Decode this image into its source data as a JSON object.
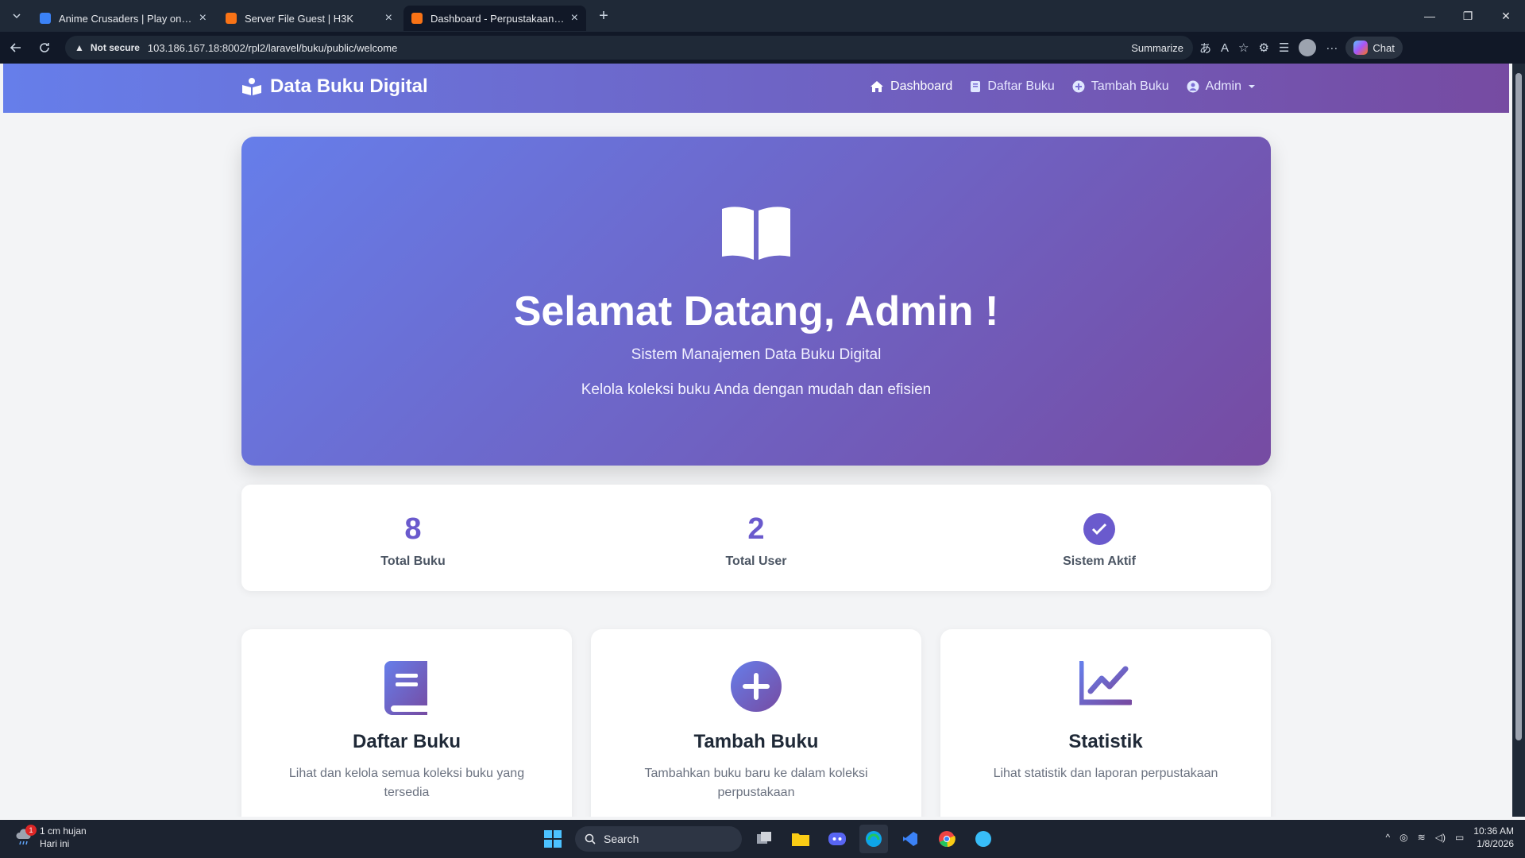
{
  "browser": {
    "tabs": [
      {
        "title": "Anime Crusaders | Play on Roblox",
        "fav_color": "#3b82f6"
      },
      {
        "title": "Server File Guest | H3K",
        "fav_color": "#f97316"
      },
      {
        "title": "Dashboard - Perpustakaan Digital",
        "fav_color": "#f97316"
      }
    ],
    "security_label": "Not secure",
    "url": "103.186.167.18:8002/rpl2/laravel/buku/public/welcome",
    "summarize_label": "Summarize",
    "chat_label": "Chat"
  },
  "navbar": {
    "brand": "Data Buku Digital",
    "items": [
      {
        "label": "Dashboard",
        "icon": "home-icon"
      },
      {
        "label": "Daftar Buku",
        "icon": "book-icon"
      },
      {
        "label": "Tambah Buku",
        "icon": "plus-circle-icon"
      },
      {
        "label": "Admin",
        "icon": "user-circle-icon"
      }
    ]
  },
  "hero": {
    "title": "Selamat Datang, Admin !",
    "subtitle": "Sistem Manajemen Data Buku Digital",
    "tagline": "Kelola koleksi buku Anda dengan mudah dan efisien"
  },
  "stats": [
    {
      "value": "8",
      "label": "Total Buku"
    },
    {
      "value": "2",
      "label": "Total User"
    },
    {
      "value": "",
      "label": "Sistem Aktif",
      "icon": "check-circle-icon"
    }
  ],
  "cards": [
    {
      "title": "Daftar Buku",
      "desc": "Lihat dan kelola semua koleksi buku yang tersedia",
      "icon": "book-icon"
    },
    {
      "title": "Tambah Buku",
      "desc": "Tambahkan buku baru ke dalam koleksi perpustakaan",
      "icon": "plus-circle-icon"
    },
    {
      "title": "Statistik",
      "desc": "Lihat statistik dan laporan perpustakaan",
      "icon": "chart-line-icon"
    }
  ],
  "taskbar": {
    "weather_text": "1 cm hujan",
    "weather_sub": "Hari ini",
    "weather_badge": "1",
    "search_label": "Search",
    "time": "10:36 AM",
    "date": "1/8/2026"
  },
  "colors": {
    "gradient_start": "#667eea",
    "gradient_end": "#764ba2",
    "accent": "#6a5acd"
  }
}
